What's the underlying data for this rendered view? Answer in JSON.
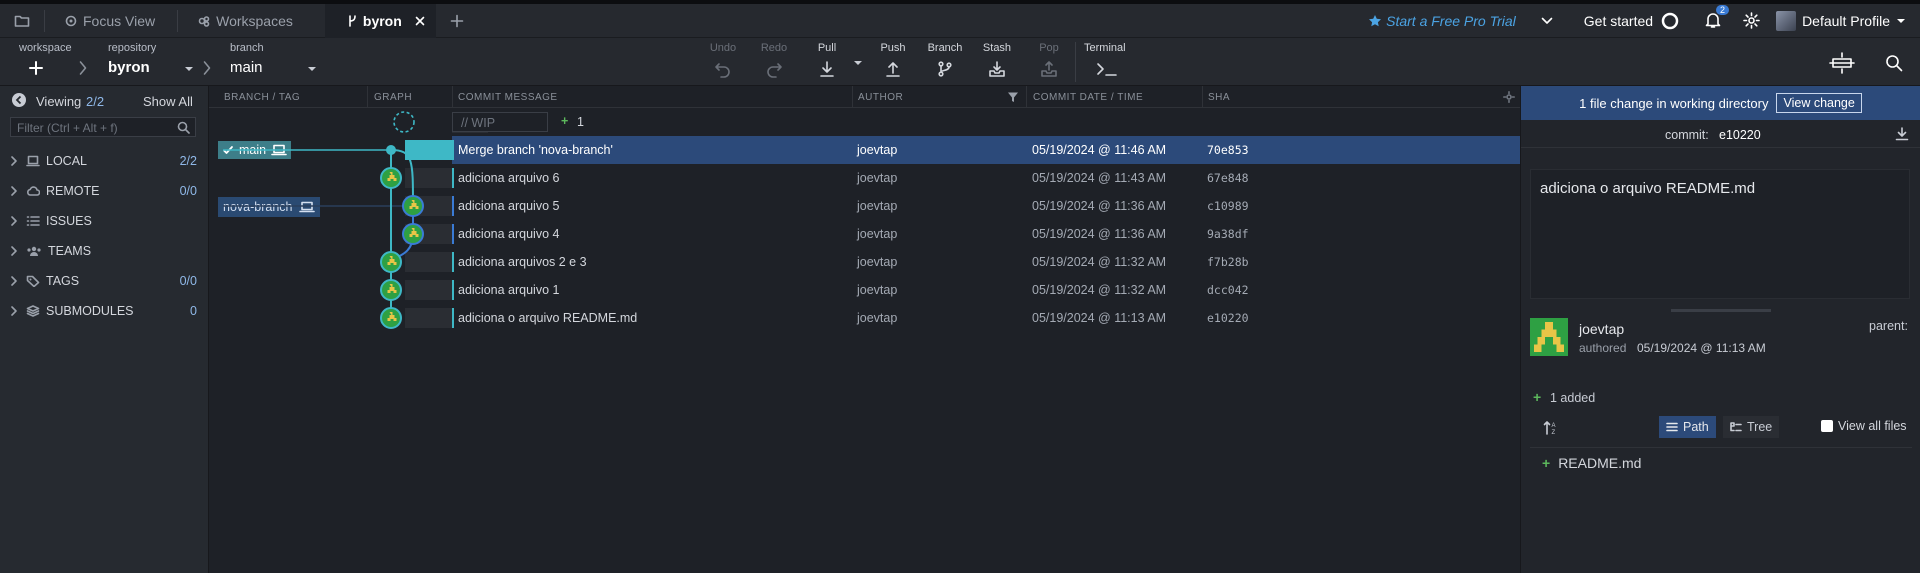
{
  "titlebar": {
    "tabs": [
      {
        "label": "Focus View"
      },
      {
        "label": "Workspaces"
      },
      {
        "label": "byron"
      }
    ],
    "pro_trial": "Start a Free Pro Trial",
    "get_started": "Get started",
    "notif_count": "2",
    "profile": "Default Profile"
  },
  "toolbar": {
    "workspace_label": "workspace",
    "repository_label": "repository",
    "repository": "byron",
    "branch_label": "branch",
    "branch": "main",
    "undo": "Undo",
    "redo": "Redo",
    "pull": "Pull",
    "push": "Push",
    "branch_btn": "Branch",
    "stash": "Stash",
    "pop": "Pop",
    "terminal": "Terminal"
  },
  "left": {
    "viewing": "Viewing",
    "viewing_count": "2/2",
    "show_all": "Show All",
    "filter_placeholder": "Filter (Ctrl + Alt + f)",
    "sections": [
      {
        "label": "LOCAL",
        "count": "2/2"
      },
      {
        "label": "REMOTE",
        "count": "0/0"
      },
      {
        "label": "ISSUES",
        "count": ""
      },
      {
        "label": "TEAMS",
        "count": ""
      },
      {
        "label": "TAGS",
        "count": "0/0"
      },
      {
        "label": "SUBMODULES",
        "count": "0"
      }
    ]
  },
  "graph": {
    "headers": {
      "branch": "BRANCH / TAG",
      "graph": "GRAPH",
      "message": "COMMIT MESSAGE",
      "author": "AUTHOR",
      "date": "COMMIT DATE / TIME",
      "sha": "SHA"
    },
    "wip_placeholder": "// WIP",
    "wip_count": "1",
    "branches": {
      "main": "main",
      "nova": "nova-branch"
    },
    "commits": [
      {
        "message": "Merge branch 'nova-branch'",
        "author": "joevtap",
        "date": "05/19/2024 @ 11:46 AM",
        "sha": "70e853"
      },
      {
        "message": "adiciona arquivo 6",
        "author": "joevtap",
        "date": "05/19/2024 @ 11:43 AM",
        "sha": "67e848"
      },
      {
        "message": "adiciona arquivo 5",
        "author": "joevtap",
        "date": "05/19/2024 @ 11:36 AM",
        "sha": "c10989"
      },
      {
        "message": "adiciona arquivo 4",
        "author": "joevtap",
        "date": "05/19/2024 @ 11:36 AM",
        "sha": "9a38df"
      },
      {
        "message": "adiciona arquivos 2 e 3",
        "author": "joevtap",
        "date": "05/19/2024 @ 11:32 AM",
        "sha": "f7b28b"
      },
      {
        "message": "adiciona arquivo 1",
        "author": "joevtap",
        "date": "05/19/2024 @ 11:32 AM",
        "sha": "dcc042"
      },
      {
        "message": "adiciona o arquivo README.md",
        "author": "joevtap",
        "date": "05/19/2024 @ 11:13 AM",
        "sha": "e10220"
      }
    ]
  },
  "detail": {
    "banner": "1 file change in working directory",
    "view_change": "View change",
    "commit_label": "commit:",
    "commit_sha": "e10220",
    "message": "adiciona o arquivo README.md",
    "author": "joevtap",
    "authored": "authored",
    "authored_date": "05/19/2024 @ 11:13 AM",
    "parent_label": "parent:",
    "added": "1 added",
    "path_btn": "Path",
    "tree_btn": "Tree",
    "view_all": "View all files",
    "file": "README.md"
  },
  "colors": {
    "accent": "#3eb8c6",
    "selected_row": "#2c4a7a",
    "green": "#5cb85c"
  }
}
